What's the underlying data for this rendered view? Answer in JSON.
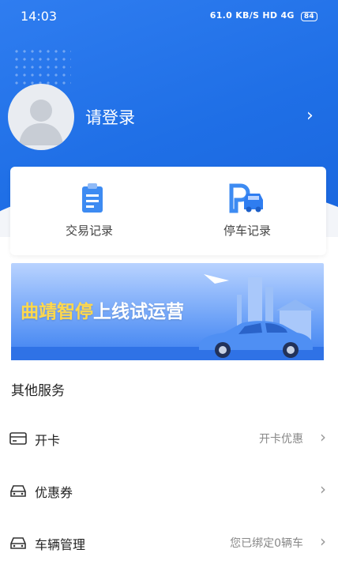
{
  "status_bar": {
    "time": "14:03",
    "network": "61.0 KB/S  HD  4G",
    "battery": "84"
  },
  "profile": {
    "login_text": "请登录"
  },
  "quick_actions": [
    {
      "label": "交易记录",
      "icon": "clipboard-icon"
    },
    {
      "label": "停车记录",
      "icon": "parking-car-icon"
    }
  ],
  "banner": {
    "title_highlight": "曲靖智停",
    "title_rest": "上线试运营"
  },
  "other_services": {
    "title": "其他服务",
    "items": [
      {
        "label": "开卡",
        "value": "开卡优惠",
        "icon": "card-icon"
      },
      {
        "label": "优惠券",
        "value": "",
        "icon": "car-coupon-icon"
      },
      {
        "label": "车辆管理",
        "value": "您已绑定0辆车",
        "icon": "car-icon"
      }
    ]
  },
  "colors": {
    "primary": "#1f6fe6",
    "banner_yellow": "#ffd84d"
  }
}
